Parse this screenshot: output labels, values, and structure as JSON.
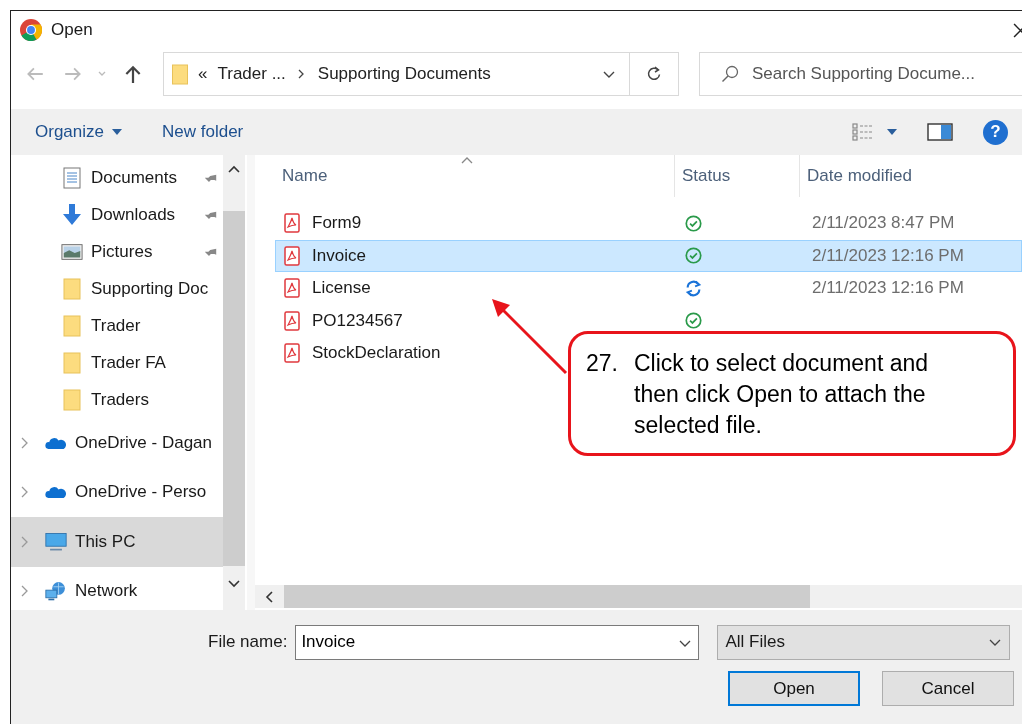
{
  "window": {
    "title": "Open"
  },
  "address_bar": {
    "overflow": "«",
    "crumbs": [
      {
        "label": "Trader ..."
      },
      {
        "label": "Supporting Documents"
      }
    ]
  },
  "search": {
    "placeholder": "Search Supporting Docume..."
  },
  "toolbar": {
    "organize": "Organize",
    "new_folder": "New folder",
    "help": "?"
  },
  "sidebar": {
    "pinned_items": [
      {
        "label": "Documents",
        "kind": "documents",
        "pinned": true
      },
      {
        "label": "Downloads",
        "kind": "downloads",
        "pinned": true
      },
      {
        "label": "Pictures",
        "kind": "pictures",
        "pinned": true
      },
      {
        "label": "Supporting Doc",
        "kind": "folder",
        "pinned": false
      },
      {
        "label": "Trader",
        "kind": "folder",
        "pinned": false
      },
      {
        "label": "Trader FA",
        "kind": "folder",
        "pinned": false
      },
      {
        "label": "Traders",
        "kind": "folder",
        "pinned": false
      }
    ],
    "root_items": [
      {
        "label": "OneDrive - Dagan",
        "kind": "cloud",
        "selected": false
      },
      {
        "label": "OneDrive - Perso",
        "kind": "cloud",
        "selected": false
      },
      {
        "label": "This PC",
        "kind": "pc",
        "selected": true
      },
      {
        "label": "Network",
        "kind": "network",
        "selected": false
      }
    ]
  },
  "file_list": {
    "columns": [
      {
        "label": "Name",
        "sorted": true
      },
      {
        "label": "Status",
        "sorted": false
      },
      {
        "label": "Date modified",
        "sorted": false
      }
    ],
    "rows": [
      {
        "name": "Form9",
        "syncing": false,
        "date": "2/11/2023 8:47 PM",
        "selected": false
      },
      {
        "name": "Invoice",
        "syncing": false,
        "date": "2/11/2023 12:16 PM",
        "selected": true
      },
      {
        "name": "License",
        "syncing": true,
        "date": "2/11/2023 12:16 PM",
        "selected": false
      },
      {
        "name": "PO1234567",
        "syncing": false,
        "selected": false
      },
      {
        "name": "StockDeclaration",
        "selected": false
      }
    ]
  },
  "file_name": {
    "label": "File name:",
    "value": "Invoice"
  },
  "file_type": {
    "value": "All Files"
  },
  "buttons": [
    {
      "label": "Open",
      "default": true
    },
    {
      "label": "Cancel",
      "default": false
    }
  ],
  "callout": {
    "number": "27.",
    "text": "Click to select document and then click Open to attach the selected file."
  }
}
